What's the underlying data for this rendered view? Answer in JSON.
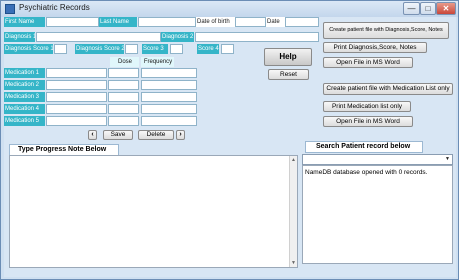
{
  "window": {
    "title": "Psychiatric Records",
    "minimize": "—",
    "maximize": "□",
    "close": "✕"
  },
  "patient": {
    "first_name_label": "First Name",
    "last_name_label": "Last Name",
    "dob_label": "Date of birth",
    "date_label": "Date"
  },
  "diagnosis": {
    "d1_label": "Diagnosis 1",
    "d2_label": "Diagnosis 2",
    "score1_label": "Diagnosis Score 1",
    "score2_label": "Diagnosis Score 2",
    "score3_label": "Score 3",
    "score4_label": "Score 4"
  },
  "medication": {
    "dose_header": "Dose",
    "frequency_header": "Frequency",
    "rows": [
      "Medication 1",
      "Medication 2",
      "Medication 3",
      "Medication 4",
      "Medication 5"
    ]
  },
  "nav": {
    "prev": "‹",
    "save": "Save",
    "delete": "Delete",
    "next": "›"
  },
  "actions": {
    "create_diagnosis": "Create patient file with  Diagnosis,Score, Notes",
    "print_diagnosis": "Print Diagnosis,Score, Notes",
    "open_word_1": "Open File in MS Word",
    "help": "Help",
    "reset": "Reset",
    "create_medication": "Create patient file with Medication List only",
    "print_medication": "Print  Medication list only",
    "open_word_2": "Open File in MS Word"
  },
  "notes": {
    "title": "Type Progress Note Below",
    "scroll_up": "▲",
    "scroll_down": "▼"
  },
  "search": {
    "title": "Search Patient record below",
    "dropdown": "▼",
    "status": "NameDB database opened with 0 records."
  }
}
